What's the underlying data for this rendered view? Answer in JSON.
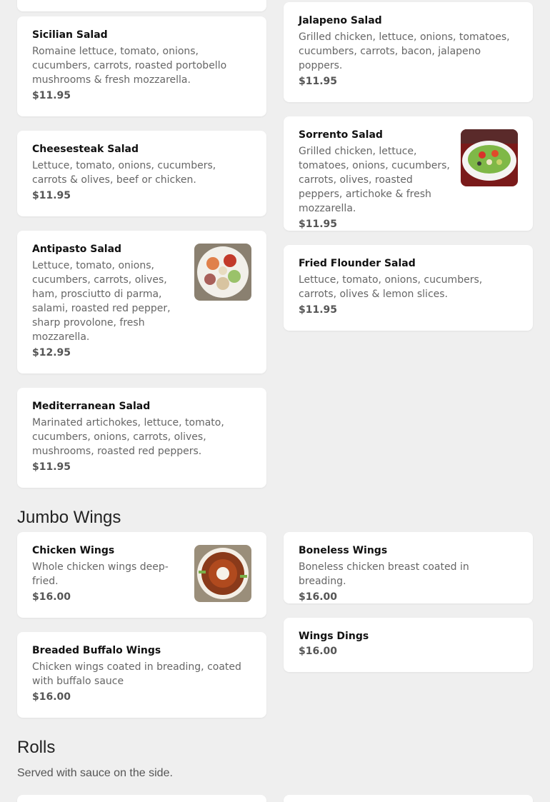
{
  "salads": {
    "items": [
      {
        "name": "Sicilian Salad",
        "desc": "Romaine lettuce, tomato, onions, cucumbers, carrots, roasted portobello mushrooms & fresh mozzarella.",
        "price": "$11.95"
      },
      {
        "name": "Jalapeno Salad",
        "desc": "Grilled chicken, lettuce, onions, tomatoes, cucumbers, carrots, bacon, jalapeno poppers.",
        "price": "$11.95"
      },
      {
        "name": "Cheesesteak Salad",
        "desc": "Lettuce, tomato, onions, cucumbers, carrots & olives, beef or chicken.",
        "price": "$11.95"
      },
      {
        "name": "Sorrento Salad",
        "desc": "Grilled chicken, lettuce, tomatoes, onions, cucumbers, carrots, olives, roasted peppers, artichoke & fresh mozzarella.",
        "price": "$11.95"
      },
      {
        "name": "Antipasto Salad",
        "desc": "Lettuce, tomato, onions, cucumbers, carrots, olives, ham, prosciutto di parma, salami, roasted red pepper, sharp provolone, fresh mozzarella.",
        "price": "$12.95"
      },
      {
        "name": "Fried Flounder Salad",
        "desc": "Lettuce, tomato, onions, cucumbers, carrots, olives & lemon slices.",
        "price": "$11.95"
      },
      {
        "name": "Mediterranean Salad",
        "desc": "Marinated artichokes, lettuce, tomato, cucumbers, onions, carrots, olives, mushrooms, roasted red peppers.",
        "price": "$11.95"
      }
    ]
  },
  "wings": {
    "title": "Jumbo Wings",
    "items": [
      {
        "name": "Chicken Wings",
        "desc": "Whole chicken wings deep-fried.",
        "price": "$16.00"
      },
      {
        "name": "Boneless Wings",
        "desc": "Boneless chicken breast coated in breading.",
        "price": "$16.00"
      },
      {
        "name": "Breaded Buffalo Wings",
        "desc": "Chicken wings coated in breading, coated with buffalo sauce",
        "price": "$16.00"
      },
      {
        "name": "Wings Dings",
        "price": "$16.00"
      }
    ]
  },
  "rolls": {
    "title": "Rolls",
    "subtitle": "Served with sauce on the side."
  }
}
